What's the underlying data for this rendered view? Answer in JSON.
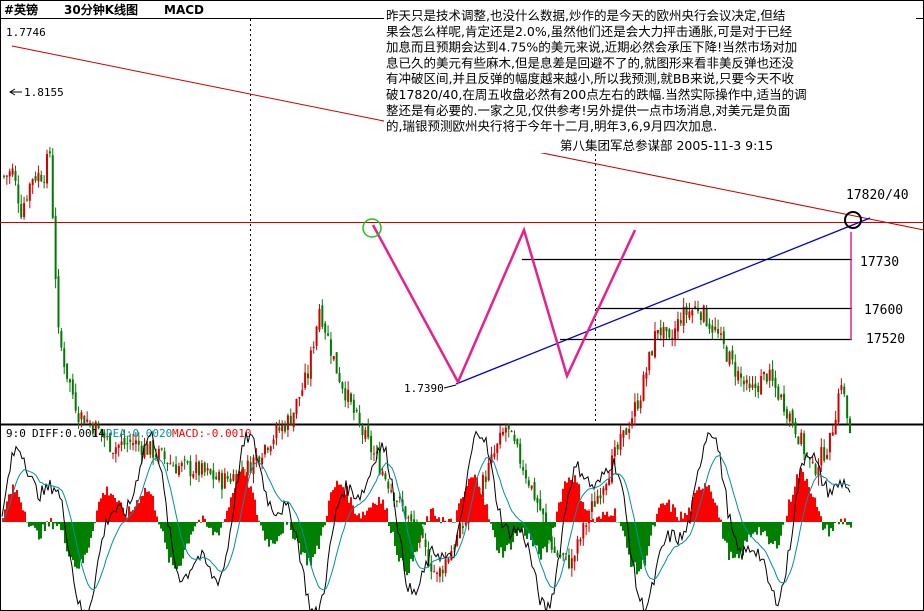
{
  "header": {
    "symbol": "#英镑",
    "timeframe": "30分钟K线图",
    "indicator": "MACD"
  },
  "price_scale_top_label": "1.7746",
  "commentary": {
    "lines": [
      "昨天只是技术调整,也没什么数据,炒作的是今天的欧州央行会议决定,但结",
      "果会怎么样呢,肯定还是2.0%,虽然他们还是会大力抨击通胀,可是对于已经",
      "加息而且预期会达到4.75%的美元来说,近期必然会承压下降!当然市场对加",
      "息已久的美元有些麻木,但是息差是回避不了的,就图形来看非美反弹也还没",
      "有冲破区间,并且反弹的幅度越来越小,所以我预测,就BB来说,只要今天不收",
      "破17820/40,在周五收盘必然有200点左右的跌幅.当然实际操作中,适当的调",
      "整还是有必要的.一家之见,仅供参考!另外提供一点市场消息,对美元是负面",
      "的,瑞银预测欧州央行将于今年十二月,明年3,6,9月四次加息."
    ],
    "signature": "第八集团军总参谋部  2005-11-3 9:15"
  },
  "annotations": {
    "high_label": "1.8155",
    "low_label": "1.7390",
    "level_resistance": "17820/40",
    "level_1": "17730",
    "level_2": "17600",
    "level_3": "17520"
  },
  "macd_legend": {
    "params": "9:0",
    "diff_label": "DIFF:0.0014",
    "dea_label": "DEA:0.0020",
    "macd_label": "MACD:-0.0010"
  },
  "colors": {
    "up_candle": "#d40000",
    "down_candle": "#007a00",
    "trendline_red": "#c80000",
    "trendline_blue": "#0000d0",
    "pattern_magenta": "#e8208c",
    "circle_green": "#20c020",
    "macd_pos": "#ff0000",
    "macd_neg": "#008000",
    "diff_line": "#000000",
    "dea_line": "#0090a0"
  },
  "chart_data": {
    "type": "candlestick",
    "symbol": "GBP/USD",
    "interval": "30分钟",
    "price_range": [
      1.7346,
      1.7746
    ],
    "high": 1.8155,
    "low": 1.739,
    "levels": [
      {
        "label": "17730",
        "price": 1.773
      },
      {
        "label": "17600",
        "price": 1.76
      },
      {
        "label": "17520",
        "price": 1.752
      }
    ],
    "close_path": [
      [
        0,
        1.7605
      ],
      [
        3,
        1.761
      ],
      [
        6,
        1.757
      ],
      [
        10,
        1.7605
      ],
      [
        14,
        1.7608
      ],
      [
        16,
        1.763
      ],
      [
        19,
        1.744
      ],
      [
        22,
        1.74
      ],
      [
        26,
        1.736
      ],
      [
        32,
        1.7345
      ],
      [
        38,
        1.7325
      ],
      [
        45,
        1.733
      ],
      [
        52,
        1.732
      ],
      [
        60,
        1.7305
      ],
      [
        68,
        1.73
      ],
      [
        76,
        1.729
      ],
      [
        84,
        1.73
      ],
      [
        92,
        1.733
      ],
      [
        100,
        1.7355
      ],
      [
        106,
        1.74
      ],
      [
        110,
        1.747
      ],
      [
        116,
        1.7405
      ],
      [
        124,
        1.7345
      ],
      [
        132,
        1.73
      ],
      [
        140,
        1.7255
      ],
      [
        148,
        1.721
      ],
      [
        151,
        1.719
      ],
      [
        157,
        1.7225
      ],
      [
        163,
        1.726
      ],
      [
        170,
        1.731
      ],
      [
        175,
        1.7345
      ],
      [
        181,
        1.7305
      ],
      [
        187,
        1.726
      ],
      [
        192,
        1.7215
      ],
      [
        198,
        1.7205
      ],
      [
        204,
        1.7255
      ],
      [
        210,
        1.7295
      ],
      [
        216,
        1.7335
      ],
      [
        222,
        1.738
      ],
      [
        228,
        1.745
      ],
      [
        232,
        1.743
      ],
      [
        236,
        1.746
      ],
      [
        242,
        1.747
      ],
      [
        248,
        1.7445
      ],
      [
        254,
        1.741
      ],
      [
        260,
        1.738
      ],
      [
        266,
        1.74
      ],
      [
        272,
        1.737
      ],
      [
        276,
        1.7345
      ],
      [
        282,
        1.73
      ],
      [
        288,
        1.733
      ],
      [
        292,
        1.7395
      ],
      [
        295,
        1.7335
      ]
    ],
    "macd": {
      "diff_last": 0.0014,
      "dea_last": 0.002,
      "macd_last": -0.001
    }
  }
}
